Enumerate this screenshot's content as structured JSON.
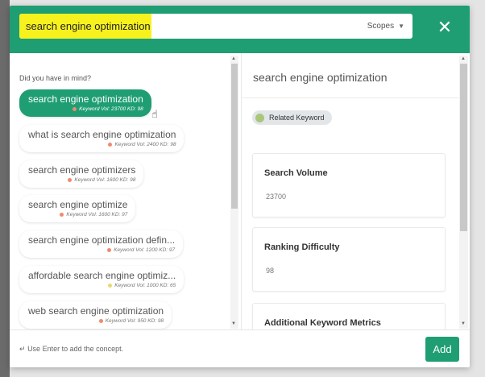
{
  "search": {
    "value": "search engine optimization",
    "scopes_label": "Scopes",
    "highlight_color": "#f7f21d"
  },
  "colors": {
    "brand": "#1f9e73",
    "related_badge": "#a8c77a"
  },
  "suggestions": {
    "heading": "Did you have in mind?",
    "items": [
      {
        "keyword": "search engine optimization",
        "meta": "Keyword Vol: 23700 KD: 98",
        "dot": "#f08a6a",
        "selected": true
      },
      {
        "keyword": "what is search engine optimization",
        "meta": "Keyword Vol: 2400 KD: 98",
        "dot": "#f08a6a"
      },
      {
        "keyword": "search engine optimizers",
        "meta": "Keyword Vol: 1600 KD: 98",
        "dot": "#f08a6a"
      },
      {
        "keyword": "search engine optimize",
        "meta": "Keyword Vol: 1600 KD: 97",
        "dot": "#f08a6a"
      },
      {
        "keyword": "search engine optimization defin...",
        "meta": "Keyword Vol: 1200 KD: 97",
        "dot": "#f08a6a"
      },
      {
        "keyword": "affordable search engine optimiz...",
        "meta": "Keyword Vol: 1000 KD: 65",
        "dot": "#e8d870"
      },
      {
        "keyword": "web search engine optimization",
        "meta": "Keyword Vol: 950 KD: 98",
        "dot": "#f08a6a"
      }
    ]
  },
  "detail": {
    "title": "search engine optimization",
    "badge": "Related Keyword",
    "cards": [
      {
        "label": "Search Volume",
        "value": "23700"
      },
      {
        "label": "Ranking Difficulty",
        "value": "98"
      },
      {
        "label": "Additional Keyword Metrics",
        "value": ""
      }
    ]
  },
  "footer": {
    "hint": "Use Enter to add the concept.",
    "add_label": "Add"
  }
}
